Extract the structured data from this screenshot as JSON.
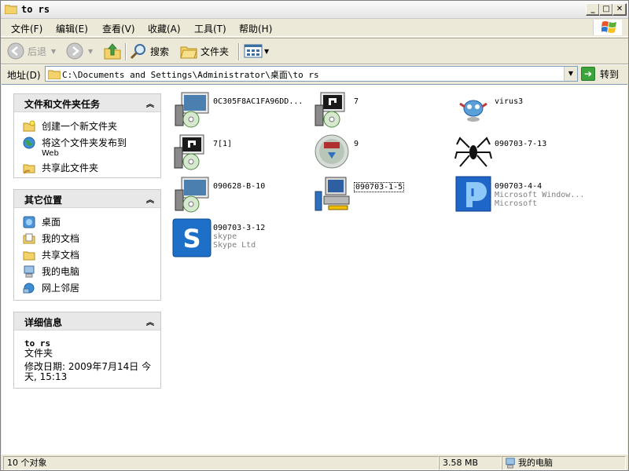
{
  "window": {
    "title": "to rs"
  },
  "menu": [
    "文件(F)",
    "编辑(E)",
    "查看(V)",
    "收藏(A)",
    "工具(T)",
    "帮助(H)"
  ],
  "toolbar": {
    "back": "后退",
    "search": "搜索",
    "folders": "文件夹"
  },
  "address": {
    "label": "地址(D)",
    "path": "C:\\Documents and Settings\\Administrator\\桌面\\to rs",
    "go": "转到"
  },
  "tasks": {
    "title": "文件和文件夹任务",
    "items": [
      {
        "label": "创建一个新文件夹",
        "sub": ""
      },
      {
        "label": "将这个文件夹发布到",
        "sub": "Web"
      },
      {
        "label": "共享此文件夹",
        "sub": ""
      }
    ]
  },
  "places": {
    "title": "其它位置",
    "items": [
      "桌面",
      "我的文档",
      "共享文档",
      "我的电脑",
      "网上邻居"
    ]
  },
  "details": {
    "title": "详细信息",
    "name": "to rs",
    "type": "文件夹",
    "modified": "修改日期: 2009年7月14日 今天, 15:13"
  },
  "files": [
    {
      "name": "0C305F8AC1FA96DD...",
      "line2": "",
      "line3": "",
      "icon": "setup-icon"
    },
    {
      "name": "7",
      "line2": "",
      "line3": "",
      "icon": "setup-icon"
    },
    {
      "name": "virus3",
      "line2": "",
      "line3": "",
      "icon": "alien-icon"
    },
    {
      "name": "7[1]",
      "line2": "",
      "line3": "",
      "icon": "setup-icon"
    },
    {
      "name": "9",
      "line2": "",
      "line3": "",
      "icon": "nsis-icon"
    },
    {
      "name": "090703-7-13",
      "line2": "",
      "line3": "",
      "icon": "spider-icon"
    },
    {
      "name": "090628-B-10",
      "line2": "",
      "line3": "",
      "icon": "setup-icon"
    },
    {
      "name": "090703-1-5",
      "line2": "",
      "line3": "",
      "icon": "installer-icon"
    },
    {
      "name": "090703-4-4",
      "line2": "Microsoft Window...",
      "line3": "Microsoft",
      "icon": "music-icon"
    },
    {
      "name": "090703-3-12",
      "line2": "skype",
      "line3": "Skype Ltd",
      "icon": "skype-icon"
    }
  ],
  "status": {
    "count": "10 个对象",
    "size": "3.58 MB",
    "zone": "我的电脑"
  },
  "colors": {
    "selection_border": "#000000",
    "panel_header": "#E8E8E8",
    "address_border": "#7F9DB9"
  }
}
